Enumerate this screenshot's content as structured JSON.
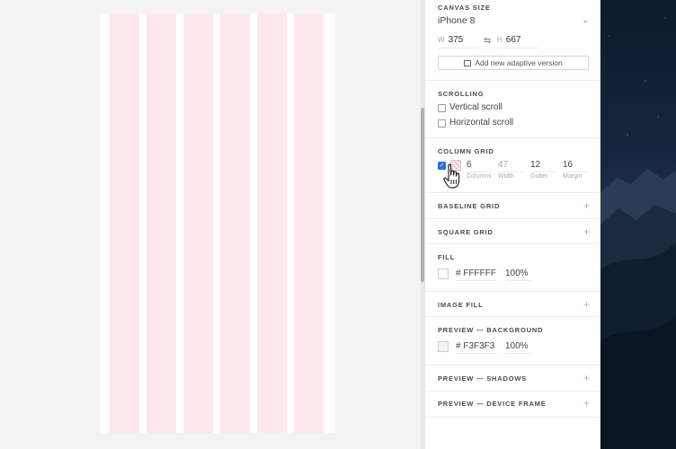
{
  "canvas": {
    "artboard_fill": "#FFFFFF",
    "grid_color": "#FDE8EE",
    "column_count": 6
  },
  "panel": {
    "canvas_size": {
      "title": "CANVAS SIZE",
      "preset": "iPhone 8",
      "width_label": "W",
      "width": "375",
      "height_label": "H",
      "height": "667",
      "adaptive_button": "Add new adaptive version"
    },
    "scrolling": {
      "title": "SCROLLING",
      "vertical": "Vertical scroll",
      "horizontal": "Horizontal scroll"
    },
    "column_grid": {
      "title": "COLUMN GRID",
      "enabled": true,
      "columns": "6",
      "columns_label": "Columns",
      "width": "47",
      "width_label": "Width",
      "gutter": "12",
      "gutter_label": "Gutter",
      "margin": "16",
      "margin_label": "Margin"
    },
    "baseline_grid": {
      "title": "BASELINE GRID"
    },
    "square_grid": {
      "title": "SQUARE GRID"
    },
    "fill": {
      "title": "FILL",
      "hex": "# FFFFFF",
      "opacity": "100%",
      "color": "#FFFFFF"
    },
    "image_fill": {
      "title": "IMAGE FILL"
    },
    "preview_background": {
      "title": "PREVIEW — BACKGROUND",
      "hex": "# F3F3F3",
      "opacity": "100%",
      "color": "#F3F3F3"
    },
    "preview_shadows": {
      "title": "PREVIEW — SHADOWS"
    },
    "preview_device_frame": {
      "title": "PREVIEW — DEVICE FRAME"
    },
    "plus_symbol": "+"
  },
  "icons": [
    "chevron-down-icon",
    "link-icon",
    "adaptive-icon",
    "checkbox-icon",
    "hand-cursor-icon",
    "plus-icon"
  ]
}
